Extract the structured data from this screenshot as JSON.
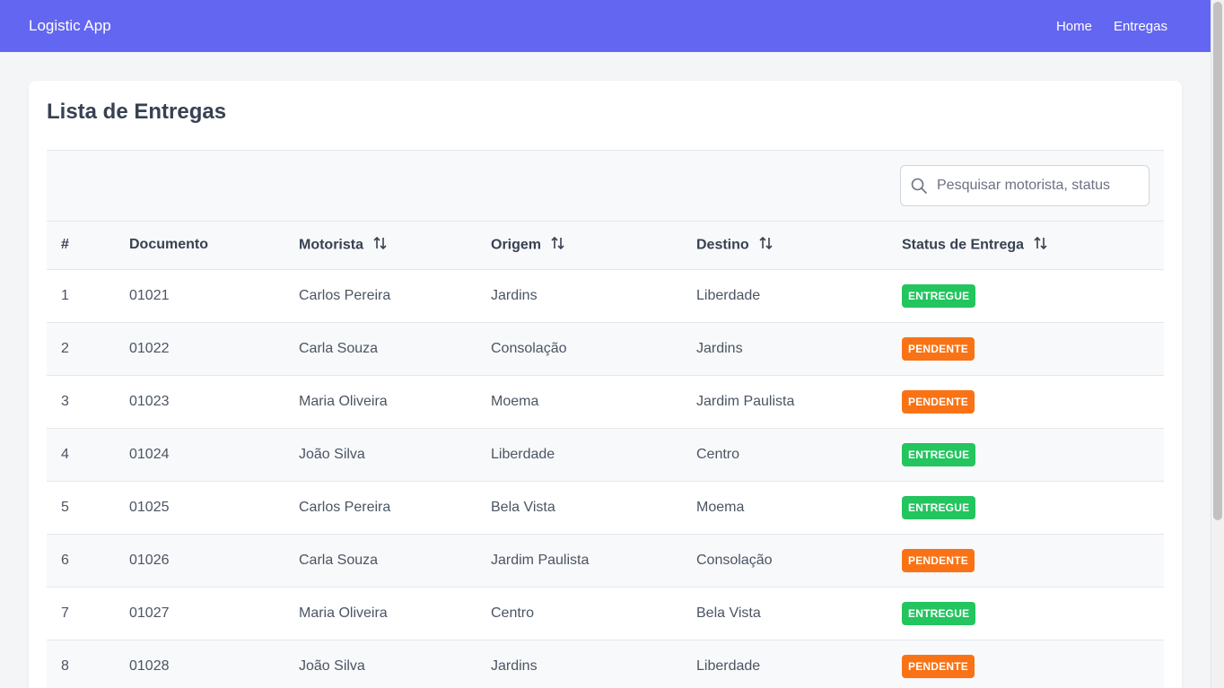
{
  "navbar": {
    "brand": "Logistic App",
    "links": [
      {
        "label": "Home"
      },
      {
        "label": "Entregas"
      }
    ]
  },
  "page": {
    "title": "Lista de Entregas"
  },
  "search": {
    "placeholder": "Pesquisar motorista, status",
    "value": "",
    "icon": "search-icon"
  },
  "table": {
    "headers": [
      "#",
      "Documento",
      "Motorista",
      "Origem",
      "Destino",
      "Status de Entrega"
    ],
    "sortable_icon": "sort-icon",
    "rows": [
      {
        "n": "1",
        "doc": "01021",
        "motorista": "Carlos Pereira",
        "origem": "Jardins",
        "destino": "Liberdade",
        "status": "ENTREGUE"
      },
      {
        "n": "2",
        "doc": "01022",
        "motorista": "Carla Souza",
        "origem": "Consolação",
        "destino": "Jardins",
        "status": "PENDENTE"
      },
      {
        "n": "3",
        "doc": "01023",
        "motorista": "Maria Oliveira",
        "origem": "Moema",
        "destino": "Jardim Paulista",
        "status": "PENDENTE"
      },
      {
        "n": "4",
        "doc": "01024",
        "motorista": "João Silva",
        "origem": "Liberdade",
        "destino": "Centro",
        "status": "ENTREGUE"
      },
      {
        "n": "5",
        "doc": "01025",
        "motorista": "Carlos Pereira",
        "origem": "Bela Vista",
        "destino": "Moema",
        "status": "ENTREGUE"
      },
      {
        "n": "6",
        "doc": "01026",
        "motorista": "Carla Souza",
        "origem": "Jardim Paulista",
        "destino": "Consolação",
        "status": "PENDENTE"
      },
      {
        "n": "7",
        "doc": "01027",
        "motorista": "Maria Oliveira",
        "origem": "Centro",
        "destino": "Bela Vista",
        "status": "ENTREGUE"
      },
      {
        "n": "8",
        "doc": "01028",
        "motorista": "João Silva",
        "origem": "Jardins",
        "destino": "Liberdade",
        "status": "PENDENTE"
      }
    ]
  },
  "colors": {
    "navbar": "#6366f1",
    "entregue": "#22c55e",
    "pendente": "#f97316"
  }
}
